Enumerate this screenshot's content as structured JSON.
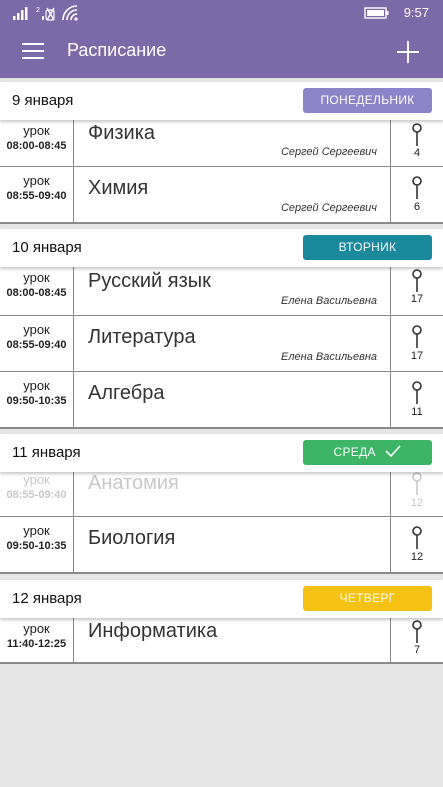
{
  "status_bar": {
    "time": "9:57"
  },
  "app": {
    "title": "Расписание"
  },
  "colors": {
    "header": "#7b6aa8",
    "monday": "#8c83c9",
    "tuesday": "#19899b",
    "wednesday": "#3db567",
    "thursday": "#f5c214"
  },
  "days": [
    {
      "date": "9 января",
      "badge": "ПОНЕДЕЛЬНИК",
      "lessons": [
        {
          "type": "урок",
          "time": "08:00-08:45",
          "subject": "Физика",
          "teacher": "Сергей Сергеевич",
          "room": "4"
        },
        {
          "type": "урок",
          "time": "08:55-09:40",
          "subject": "Химия",
          "teacher": "Сергей Сергеевич",
          "room": "6"
        }
      ]
    },
    {
      "date": "10 января",
      "badge": "ВТОРНИК",
      "lessons": [
        {
          "type": "урок",
          "time": "08:00-08:45",
          "subject": "Русский язык",
          "teacher": "Елена Васильевна",
          "room": "17"
        },
        {
          "type": "урок",
          "time": "08:55-09:40",
          "subject": "Литература",
          "teacher": "Елена Васильевна",
          "room": "17"
        },
        {
          "type": "урок",
          "time": "09:50-10:35",
          "subject": "Алгебра",
          "teacher": "",
          "room": "11"
        }
      ]
    },
    {
      "date": "11 января",
      "badge": "СРЕДА",
      "lessons": [
        {
          "type": "урок",
          "time": "08:55-09:40",
          "subject": "Анатомия",
          "teacher": "",
          "room": "12"
        },
        {
          "type": "урок",
          "time": "09:50-10:35",
          "subject": "Биология",
          "teacher": "",
          "room": "12"
        }
      ]
    },
    {
      "date": "12 января",
      "badge": "ЧЕТВЕРГ",
      "lessons": [
        {
          "type": "урок",
          "time": "11:40-12:25",
          "subject": "Информатика",
          "teacher": "",
          "room": "7"
        }
      ]
    }
  ]
}
